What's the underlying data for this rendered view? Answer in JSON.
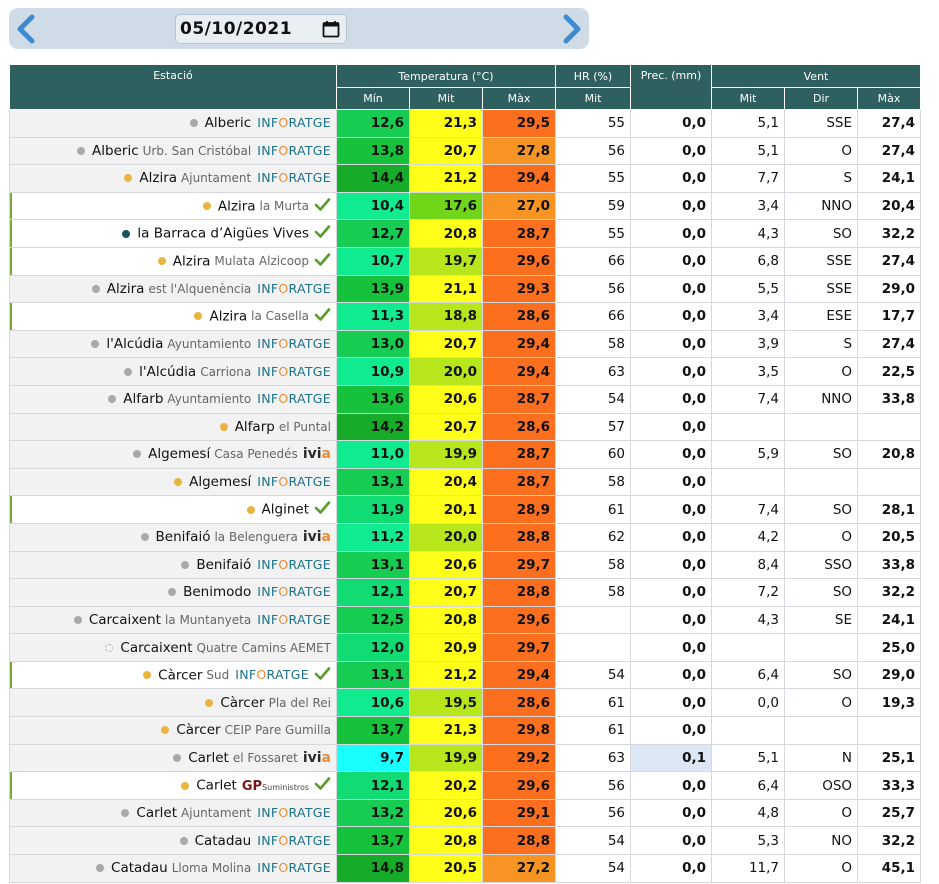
{
  "date": {
    "value": "05/10/2021",
    "prev_icon": "chevron-left-icon",
    "next_icon": "chevron-right-icon",
    "calendar_icon": "calendar-icon"
  },
  "colors": {
    "header_bg": "#2e6060",
    "bar_bg": "#cfdbe6",
    "arrow": "#3f8bd0",
    "check": "#5a9b2a",
    "temp_scale": [
      "#19ffff",
      "#11eb8f",
      "#11db73",
      "#16cc52",
      "#16c23b",
      "#71d61a",
      "#b7e61c",
      "#f3f316",
      "#ffff1a",
      "#f79424",
      "#fb6f1e",
      "#f86421"
    ]
  },
  "headers": {
    "station": "Estació",
    "temperature": "Temperatura (°C)",
    "hr": "HR (%)",
    "prec": "Prec. (mm)",
    "wind": "Vent",
    "min": "Mín",
    "mit": "Mit",
    "max": "Màx",
    "hr_mit": "Mit",
    "wind_mit": "Mit",
    "wind_dir": "Dir",
    "wind_max": "Màx"
  },
  "rows": [
    {
      "name": "Alberic",
      "sub": "",
      "brand": "info",
      "verified": false,
      "dot": "g",
      "hl": false,
      "min": "12,6",
      "mit": "21,3",
      "max": "29,5",
      "minc": "#16cc52",
      "mitc": "#ffff1a",
      "maxc": "#fb6f1e",
      "hr": "55",
      "prec": "0,0",
      "wm": "5,1",
      "wd": "SSE",
      "wx": "27,4"
    },
    {
      "name": "Alberic",
      "sub": "Urb. San Cristóbal",
      "brand": "info",
      "verified": false,
      "dot": "g",
      "hl": false,
      "min": "13,8",
      "mit": "20,7",
      "max": "27,8",
      "minc": "#16c23b",
      "mitc": "#ffff1a",
      "maxc": "#f79424",
      "hr": "56",
      "prec": "0,0",
      "wm": "5,1",
      "wd": "O",
      "wx": "27,4"
    },
    {
      "name": "Alzira",
      "sub": "Ajuntament",
      "brand": "info",
      "verified": false,
      "dot": "y",
      "hl": false,
      "min": "14,4",
      "mit": "21,2",
      "max": "29,4",
      "minc": "#16ab28",
      "mitc": "#ffff1a",
      "maxc": "#fb6f1e",
      "hr": "55",
      "prec": "0,0",
      "wm": "7,7",
      "wd": "S",
      "wx": "24,1"
    },
    {
      "name": "Alzira",
      "sub": "la Murta",
      "brand": "",
      "verified": true,
      "dot": "y",
      "hl": true,
      "min": "10,4",
      "mit": "17,6",
      "max": "27,0",
      "minc": "#11eb8f",
      "mitc": "#71d61a",
      "maxc": "#f79424",
      "hr": "59",
      "prec": "0,0",
      "wm": "3,4",
      "wd": "NNO",
      "wx": "20,4"
    },
    {
      "name": "la Barraca d’Aigües Vives",
      "sub": "",
      "brand": "",
      "verified": true,
      "dot": "t",
      "hl": true,
      "min": "12,7",
      "mit": "20,8",
      "max": "28,7",
      "minc": "#16cc52",
      "mitc": "#ffff1a",
      "maxc": "#fb6f1e",
      "hr": "55",
      "prec": "0,0",
      "wm": "4,3",
      "wd": "SO",
      "wx": "32,2"
    },
    {
      "name": "Alzira",
      "sub": "Mulata Alzicoop",
      "brand": "",
      "verified": true,
      "dot": "y",
      "hl": true,
      "min": "10,7",
      "mit": "19,7",
      "max": "29,6",
      "minc": "#11eb8f",
      "mitc": "#b7e61c",
      "maxc": "#fb6f1e",
      "hr": "66",
      "prec": "0,0",
      "wm": "6,8",
      "wd": "SSE",
      "wx": "27,4"
    },
    {
      "name": "Alzira",
      "sub": "est l'Alquenència",
      "brand": "info",
      "verified": false,
      "dot": "g",
      "hl": false,
      "min": "13,9",
      "mit": "21,1",
      "max": "29,3",
      "minc": "#16c23b",
      "mitc": "#ffff1a",
      "maxc": "#fb6f1e",
      "hr": "56",
      "prec": "0,0",
      "wm": "5,5",
      "wd": "SSE",
      "wx": "29,0"
    },
    {
      "name": "Alzira",
      "sub": "la Casella",
      "brand": "",
      "verified": true,
      "dot": "y",
      "hl": true,
      "min": "11,3",
      "mit": "18,8",
      "max": "28,6",
      "minc": "#11eb8f",
      "mitc": "#b7e61c",
      "maxc": "#fb6f1e",
      "hr": "66",
      "prec": "0,0",
      "wm": "3,4",
      "wd": "ESE",
      "wx": "17,7"
    },
    {
      "name": "l'Alcúdia",
      "sub": "Ayuntamiento",
      "brand": "info",
      "verified": false,
      "dot": "g",
      "hl": false,
      "min": "13,0",
      "mit": "20,7",
      "max": "29,4",
      "minc": "#16cc52",
      "mitc": "#ffff1a",
      "maxc": "#fb6f1e",
      "hr": "58",
      "prec": "0,0",
      "wm": "3,9",
      "wd": "S",
      "wx": "27,4"
    },
    {
      "name": "l'Alcúdia",
      "sub": "Carriona",
      "brand": "info",
      "verified": false,
      "dot": "g",
      "hl": false,
      "min": "10,9",
      "mit": "20,0",
      "max": "29,4",
      "minc": "#11eb8f",
      "mitc": "#b7e61c",
      "maxc": "#fb6f1e",
      "hr": "63",
      "prec": "0,0",
      "wm": "3,5",
      "wd": "O",
      "wx": "22,5"
    },
    {
      "name": "Alfarb",
      "sub": "Ayuntamiento",
      "brand": "info",
      "verified": false,
      "dot": "g",
      "hl": false,
      "min": "13,6",
      "mit": "20,6",
      "max": "28,7",
      "minc": "#16c23b",
      "mitc": "#ffff1a",
      "maxc": "#fb6f1e",
      "hr": "54",
      "prec": "0,0",
      "wm": "7,4",
      "wd": "NNO",
      "wx": "33,8"
    },
    {
      "name": "Alfarp",
      "sub": "el Puntal",
      "brand": "",
      "verified": false,
      "dot": "y",
      "hl": false,
      "min": "14,2",
      "mit": "20,7",
      "max": "28,6",
      "minc": "#16ab28",
      "mitc": "#ffff1a",
      "maxc": "#fb6f1e",
      "hr": "57",
      "prec": "0,0",
      "wm": "",
      "wd": "",
      "wx": ""
    },
    {
      "name": "Algemesí",
      "sub": "Casa Penedés",
      "brand": "ivia",
      "verified": false,
      "dot": "g",
      "hl": false,
      "min": "11,0",
      "mit": "19,9",
      "max": "28,7",
      "minc": "#11eb8f",
      "mitc": "#b7e61c",
      "maxc": "#fb6f1e",
      "hr": "60",
      "prec": "0,0",
      "wm": "5,9",
      "wd": "SO",
      "wx": "20,8"
    },
    {
      "name": "Algemesí",
      "sub": "",
      "brand": "info",
      "verified": false,
      "dot": "y",
      "hl": false,
      "min": "13,1",
      "mit": "20,4",
      "max": "28,7",
      "minc": "#16cc52",
      "mitc": "#ffff1a",
      "maxc": "#fb6f1e",
      "hr": "58",
      "prec": "0,0",
      "wm": "",
      "wd": "",
      "wx": ""
    },
    {
      "name": "Alginet",
      "sub": "",
      "brand": "",
      "verified": true,
      "dot": "y",
      "hl": true,
      "min": "11,9",
      "mit": "20,1",
      "max": "28,9",
      "minc": "#11db73",
      "mitc": "#ffff1a",
      "maxc": "#fb6f1e",
      "hr": "61",
      "prec": "0,0",
      "wm": "7,4",
      "wd": "SO",
      "wx": "28,1"
    },
    {
      "name": "Benifaió",
      "sub": "la Belenguera",
      "brand": "ivia",
      "verified": false,
      "dot": "g",
      "hl": false,
      "min": "11,2",
      "mit": "20,0",
      "max": "28,8",
      "minc": "#11eb8f",
      "mitc": "#b7e61c",
      "maxc": "#fb6f1e",
      "hr": "62",
      "prec": "0,0",
      "wm": "4,2",
      "wd": "O",
      "wx": "20,5"
    },
    {
      "name": "Benifaió",
      "sub": "",
      "brand": "info",
      "verified": false,
      "dot": "g",
      "hl": false,
      "min": "13,1",
      "mit": "20,6",
      "max": "29,7",
      "minc": "#16cc52",
      "mitc": "#ffff1a",
      "maxc": "#fb6f1e",
      "hr": "58",
      "prec": "0,0",
      "wm": "8,4",
      "wd": "SSO",
      "wx": "33,8"
    },
    {
      "name": "Benimodo",
      "sub": "",
      "brand": "info",
      "verified": false,
      "dot": "g",
      "hl": false,
      "min": "12,1",
      "mit": "20,7",
      "max": "28,8",
      "minc": "#11db73",
      "mitc": "#ffff1a",
      "maxc": "#fb6f1e",
      "hr": "58",
      "prec": "0,0",
      "wm": "7,2",
      "wd": "SO",
      "wx": "32,2"
    },
    {
      "name": "Carcaixent",
      "sub": "la Muntanyeta",
      "brand": "info",
      "verified": false,
      "dot": "g",
      "hl": false,
      "min": "12,5",
      "mit": "20,8",
      "max": "29,6",
      "minc": "#16cc52",
      "mitc": "#ffff1a",
      "maxc": "#fb6f1e",
      "hr": "",
      "prec": "0,0",
      "wm": "4,3",
      "wd": "SE",
      "wx": "24,1"
    },
    {
      "name": "Carcaixent",
      "sub": "Quatre Camins AEMET",
      "brand": "",
      "verified": false,
      "dot": "o",
      "hl": false,
      "min": "12,0",
      "mit": "20,9",
      "max": "29,7",
      "minc": "#11db73",
      "mitc": "#ffff1a",
      "maxc": "#fb6f1e",
      "hr": "",
      "prec": "0,0",
      "wm": "",
      "wd": "",
      "wx": "25,0"
    },
    {
      "name": "Càrcer",
      "sub": "Sud",
      "brand": "info",
      "verified": true,
      "dot": "y",
      "hl": true,
      "min": "13,1",
      "mit": "21,2",
      "max": "29,4",
      "minc": "#16cc52",
      "mitc": "#ffff1a",
      "maxc": "#fb6f1e",
      "hr": "54",
      "prec": "0,0",
      "wm": "6,4",
      "wd": "SO",
      "wx": "29,0"
    },
    {
      "name": "Càrcer",
      "sub": "Pla del Rei",
      "brand": "",
      "verified": false,
      "dot": "y",
      "hl": false,
      "min": "10,6",
      "mit": "19,5",
      "max": "28,6",
      "minc": "#11eb8f",
      "mitc": "#b7e61c",
      "maxc": "#fb6f1e",
      "hr": "61",
      "prec": "0,0",
      "wm": "0,0",
      "wd": "O",
      "wx": "19,3"
    },
    {
      "name": "Càrcer",
      "sub": "CEIP Pare Gumilla",
      "brand": "",
      "verified": false,
      "dot": "y",
      "hl": false,
      "min": "13,7",
      "mit": "21,3",
      "max": "29,8",
      "minc": "#16c23b",
      "mitc": "#ffff1a",
      "maxc": "#fb6f1e",
      "hr": "61",
      "prec": "0,0",
      "wm": "",
      "wd": "",
      "wx": ""
    },
    {
      "name": "Carlet",
      "sub": "el Fossaret",
      "brand": "ivia",
      "verified": false,
      "dot": "g",
      "hl": false,
      "min": "9,7",
      "mit": "19,9",
      "max": "29,2",
      "minc": "#19ffff",
      "mitc": "#b7e61c",
      "maxc": "#fb6f1e",
      "hr": "63",
      "prec": "0,1",
      "rain": true,
      "wm": "5,1",
      "wd": "N",
      "wx": "25,1"
    },
    {
      "name": "Carlet",
      "sub": "",
      "brand": "gp",
      "verified": true,
      "dot": "y",
      "hl": true,
      "min": "12,1",
      "mit": "20,2",
      "max": "29,6",
      "minc": "#11db73",
      "mitc": "#ffff1a",
      "maxc": "#fb6f1e",
      "hr": "56",
      "prec": "0,0",
      "wm": "6,4",
      "wd": "OSO",
      "wx": "33,3"
    },
    {
      "name": "Carlet",
      "sub": "Ajuntament",
      "brand": "info",
      "verified": false,
      "dot": "g",
      "hl": false,
      "min": "13,2",
      "mit": "20,6",
      "max": "29,1",
      "minc": "#16cc52",
      "mitc": "#ffff1a",
      "maxc": "#fb6f1e",
      "hr": "56",
      "prec": "0,0",
      "wm": "4,8",
      "wd": "O",
      "wx": "25,7"
    },
    {
      "name": "Catadau",
      "sub": "",
      "brand": "info",
      "verified": false,
      "dot": "g",
      "hl": false,
      "min": "13,7",
      "mit": "20,8",
      "max": "28,8",
      "minc": "#16c23b",
      "mitc": "#ffff1a",
      "maxc": "#fb6f1e",
      "hr": "54",
      "prec": "0,0",
      "wm": "5,3",
      "wd": "NO",
      "wx": "32,2"
    },
    {
      "name": "Catadau",
      "sub": "Lloma Molina",
      "brand": "info",
      "verified": false,
      "dot": "g",
      "hl": false,
      "min": "14,8",
      "mit": "20,5",
      "max": "27,2",
      "minc": "#16ab28",
      "mitc": "#ffff1a",
      "maxc": "#f79424",
      "hr": "54",
      "prec": "0,0",
      "wm": "11,7",
      "wd": "O",
      "wx": "45,1"
    }
  ]
}
